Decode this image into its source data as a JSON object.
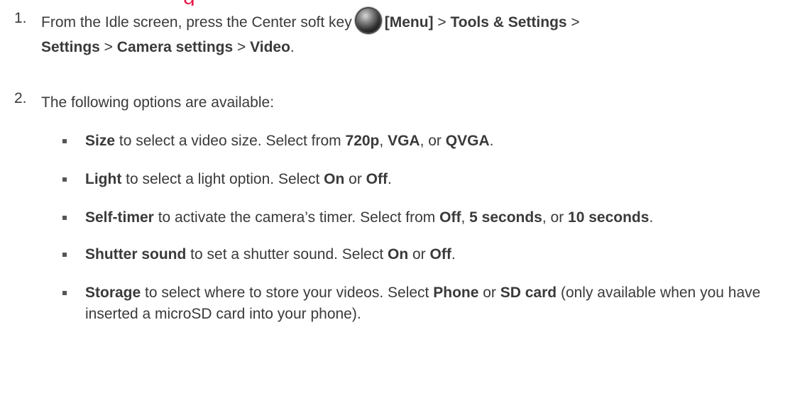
{
  "heading_fragment": "g",
  "step1": {
    "number": "1.",
    "text_a": "From the Idle screen, press the Center soft key",
    "key_icon": "center-soft-key-icon",
    "menu": "[Menu]",
    "sep1": " > ",
    "tools": "Tools & Settings",
    "sep2": " >",
    "settings": "Settings",
    "sep3": " > ",
    "camera": "Camera settings",
    "sep4": " > ",
    "video": "Video",
    "end": "."
  },
  "step2": {
    "number": "2.",
    "text": "The following options are available:"
  },
  "options": [
    {
      "term": "Size",
      "desc": " to select a video size. Select from ",
      "c1": "720p",
      "s1": ", ",
      "c2": "VGA",
      "s2": ", or ",
      "c3": "QVGA",
      "end": "."
    },
    {
      "term": "Light",
      "desc": " to select a light option. Select ",
      "c1": "On",
      "s1": " or ",
      "c2": "Off",
      "end": "."
    },
    {
      "term": "Self-timer",
      "desc": " to activate the camera’s timer. Select from ",
      "c1": "Off",
      "s1": ", ",
      "c2": "5 seconds",
      "s2": ", or ",
      "c3": "10 seconds",
      "end": "."
    },
    {
      "term": "Shutter sound",
      "desc": " to set a shutter sound. Select ",
      "c1": "On",
      "s1": " or ",
      "c2": "Off",
      "end": "."
    },
    {
      "term": "Storage",
      "desc": " to select where to store your videos. Select ",
      "c1": "Phone",
      "s1": " or ",
      "c2": "SD card",
      "tail": " (only available when you have inserted a microSD card into your phone)."
    }
  ],
  "colors": {
    "heading": "#e8194b",
    "text": "#3a3a3a"
  }
}
